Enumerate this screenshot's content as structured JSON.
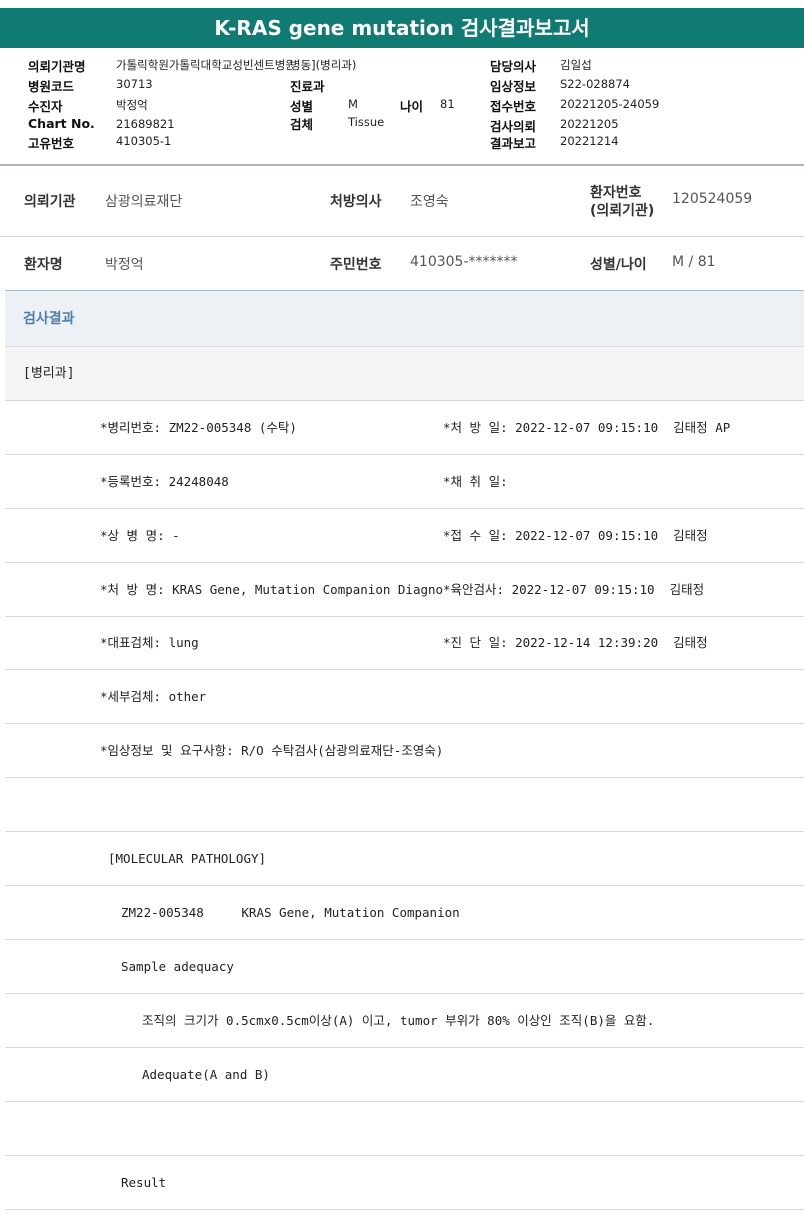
{
  "report_title": "K-RAS gene mutation 검사결과보고서",
  "header": {
    "institution_label": "의뢰기관명",
    "institution_value": "가톨릭학원가톨릭대학교성빈센트병원",
    "department": "병동](병리과)",
    "hospital_code_label": "병원코드",
    "hospital_code_value": "30713",
    "clinic_label": "진료과",
    "collector_label": "수진자",
    "collector_value": "박정억",
    "sex_label": "성별",
    "sex_value": "M",
    "age_label": "나이",
    "age_value": "81",
    "chart_label": "Chart No.",
    "chart_value": "21689821",
    "specimen_label": "검체",
    "specimen_value": "Tissue",
    "unique_label": "고유번호",
    "unique_value": "410305-1",
    "doctor_label": "담당의사",
    "doctor_value": "김일섭",
    "clinical_label": "임상정보",
    "clinical_value": "S22-028874",
    "receipt_label": "접수번호",
    "receipt_value": "20221205-24059",
    "request_label": "검사의뢰",
    "request_value": "20221205",
    "result_label": "결과보고",
    "result_value": "20221214"
  },
  "info": {
    "org_label": "의뢰기관",
    "org_value": "삼광의료재단",
    "prescriber_label": "처방의사",
    "prescriber_value": "조영숙",
    "patient_no_label_1": "환자번호",
    "patient_no_label_2": "(의뢰기관)",
    "patient_no_value": "120524059",
    "name_label": "환자명",
    "name_value": "박정억",
    "rrn_label": "주민번호",
    "rrn_value": "410305-*******",
    "sexage_label": "성별/나이",
    "sexage_value": "M / 81"
  },
  "section_title": "검사결과",
  "sub_title": "[병리과]",
  "rows": [
    {
      "left": "*병리번호: ZM22-005348 (수탁)",
      "right": "*처 방 일: 2022-12-07 09:15:10  김태정 AP"
    },
    {
      "left": "*등록번호: 24248048",
      "right": "*채 취 일:"
    },
    {
      "left": "*상 병 명: -",
      "right": "*접 수 일: 2022-12-07 09:15:10  김태정"
    },
    {
      "left": "*처 방 명: KRAS Gene, Mutation Companion Diagno",
      "right": "*육안검사: 2022-12-07 09:15:10  김태정"
    },
    {
      "left": "*대표검체: lung",
      "right": "*진 단 일: 2022-12-14 12:39:20  김태정"
    },
    {
      "left": "*세부검체: other",
      "right": ""
    },
    {
      "left": "*임상정보 및 요구사항: R/O 수탁검사(삼광의료재단-조영숙)",
      "right": ""
    },
    {
      "left": "",
      "right": ""
    },
    {
      "left": "[MOLECULAR PATHOLOGY]",
      "right": ""
    },
    {
      "left": "ZM22-005348     KRAS Gene, Mutation Companion",
      "right": ""
    },
    {
      "left": "Sample adequacy",
      "right": ""
    },
    {
      "left": "조직의 크기가 0.5cmx0.5cm이상(A) 이고, tumor 부위가 80% 이상인 조직(B)을 요함.",
      "right": ""
    },
    {
      "left": "Adequate(A and B)",
      "right": ""
    },
    {
      "left": "",
      "right": ""
    },
    {
      "left": "Result",
      "right": ""
    }
  ]
}
